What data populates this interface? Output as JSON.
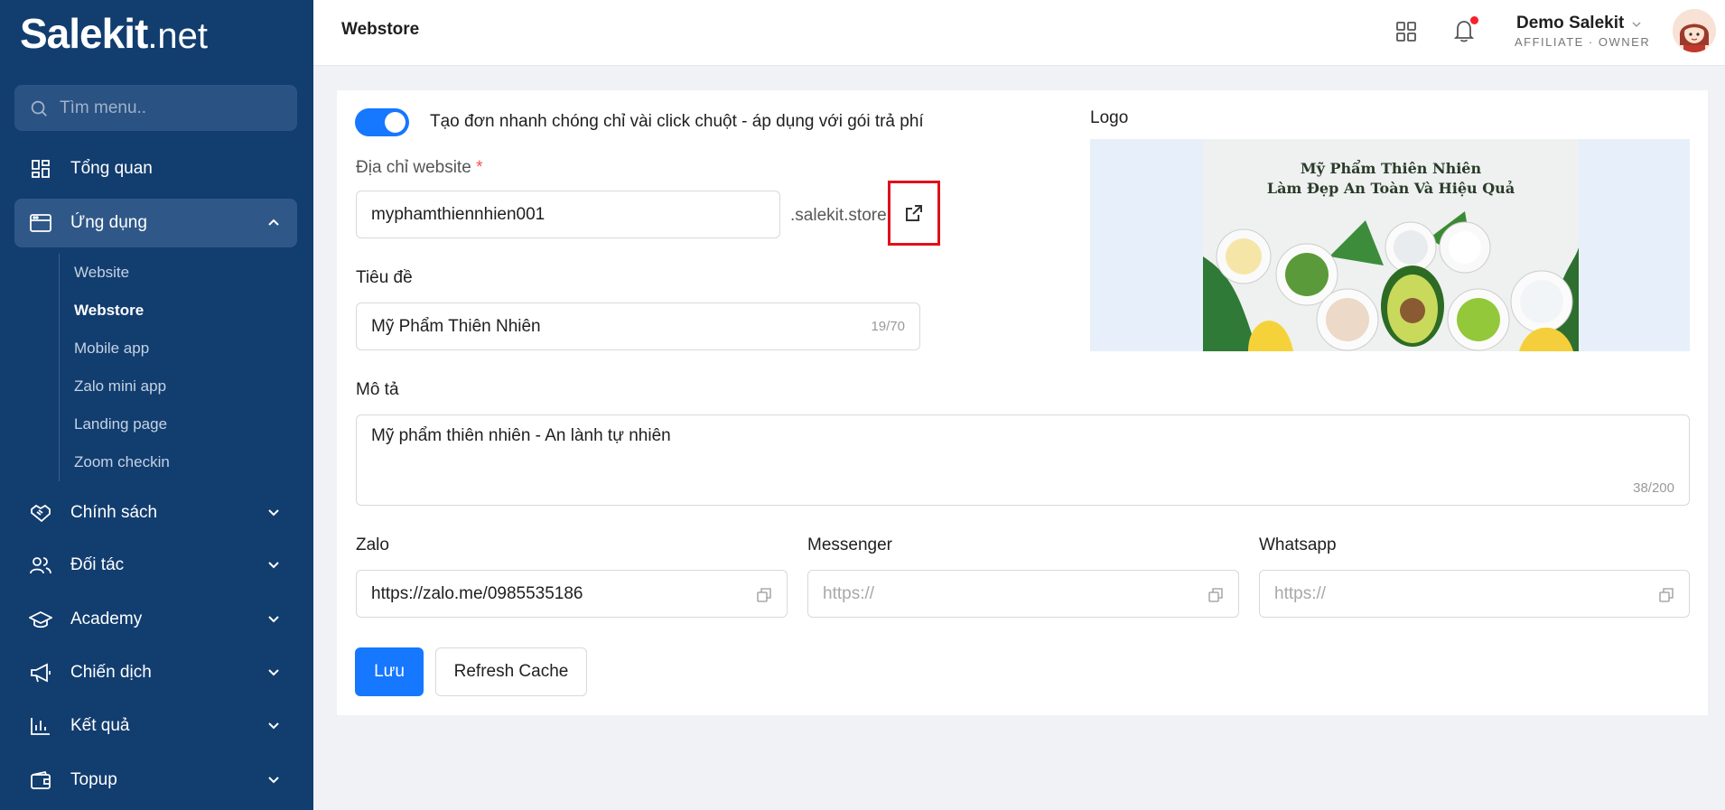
{
  "brand": {
    "name_bold": "Salekit",
    "name_light": ".net"
  },
  "sidebar": {
    "search_placeholder": "Tìm menu..",
    "items": [
      {
        "label": "Tổng quan",
        "icon": "dashboard-icon"
      },
      {
        "label": "Ứng dụng",
        "icon": "app-window-icon",
        "expanded": true
      },
      {
        "label": "Chính sách",
        "icon": "handshake-icon"
      },
      {
        "label": "Đối tác",
        "icon": "users-icon"
      },
      {
        "label": "Academy",
        "icon": "graduation-cap-icon"
      },
      {
        "label": "Chiến dịch",
        "icon": "megaphone-icon"
      },
      {
        "label": "Kết quả",
        "icon": "bar-chart-icon"
      },
      {
        "label": "Topup",
        "icon": "wallet-icon"
      }
    ],
    "submenu": [
      "Website",
      "Webstore",
      "Mobile app",
      "Zalo mini app",
      "Landing page",
      "Zoom checkin"
    ],
    "active_submenu": "Webstore"
  },
  "header": {
    "title": "Webstore",
    "user_name": "Demo Salekit",
    "user_role": "AFFILIATE · OWNER"
  },
  "form": {
    "toggle_label": "Tạo đơn nhanh chóng chỉ vài click chuột - áp dụng với gói trả phí",
    "toggle_on": true,
    "website_label": "Địa chỉ website",
    "website_required": "*",
    "website_value": "myphamthiennhien001",
    "website_suffix": ".salekit.store",
    "title_label": "Tiêu đề",
    "title_value": "Mỹ Phẩm Thiên Nhiên",
    "title_count": "19/70",
    "desc_label": "Mô tả",
    "desc_value": "Mỹ phẩm thiên nhiên - An lành tự nhiên",
    "desc_count": "38/200",
    "zalo_label": "Zalo",
    "zalo_value": "https://zalo.me/0985535186",
    "messenger_label": "Messenger",
    "messenger_placeholder": "https://",
    "whatsapp_label": "Whatsapp",
    "whatsapp_placeholder": "https://",
    "logo_label": "Logo",
    "logo_text_line1": "Mỹ Phẩm Thiên Nhiên",
    "logo_text_line2": "Làm Đẹp An Toàn Và Hiệu Quả",
    "save_label": "Lưu",
    "refresh_label": "Refresh Cache"
  },
  "colors": {
    "sidebar_bg": "#123d6f",
    "primary": "#1677ff",
    "highlight_border": "#e0101a"
  }
}
